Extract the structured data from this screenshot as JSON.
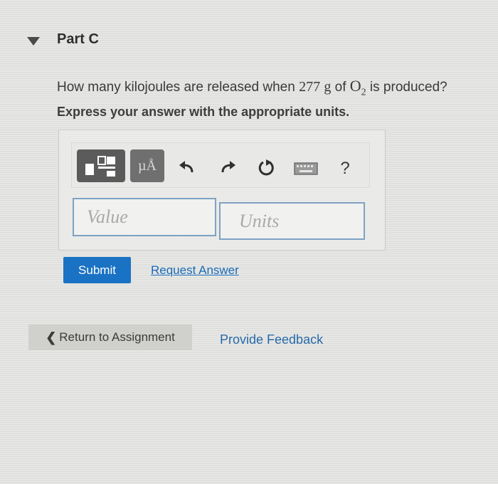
{
  "part": {
    "title": "Part C",
    "toggle_icon": "triangle-down-icon"
  },
  "question": {
    "prefix": "How many kilojoules are released when ",
    "mass": "277",
    "unit": "g",
    "of_text": " of ",
    "formula_base": "O",
    "formula_sub": "2",
    "suffix": " is produced?",
    "instruction": "Express your answer with the appropriate units."
  },
  "toolbar": {
    "templates_icon": "templates-icon",
    "units_label": "µÅ",
    "undo_icon": "undo-icon",
    "redo_icon": "redo-icon",
    "reset_icon": "reset-icon",
    "keyboard_icon": "keyboard-icon",
    "help_label": "?"
  },
  "answer": {
    "value_placeholder": "Value",
    "value": "",
    "units_placeholder": "Units",
    "units": ""
  },
  "actions": {
    "submit_label": "Submit",
    "request_answer_label": "Request Answer"
  },
  "footer": {
    "return_label": "Return to Assignment",
    "feedback_label": "Provide Feedback"
  },
  "colors": {
    "primary": "#1a72c4",
    "link": "#1a6ab8",
    "input_border": "#7ea2c2",
    "toolbar_dark": "#5b5b5b"
  }
}
